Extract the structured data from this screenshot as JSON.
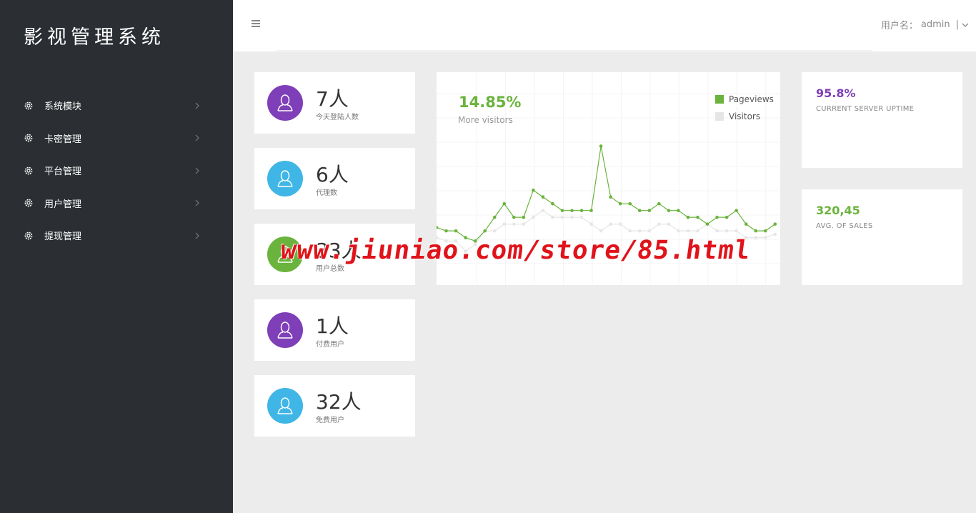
{
  "app": {
    "title": "影视管理系统"
  },
  "sidebar": {
    "items": [
      {
        "label": "系统模块"
      },
      {
        "label": "卡密管理"
      },
      {
        "label": "平台管理"
      },
      {
        "label": "用户管理"
      },
      {
        "label": "提现管理"
      }
    ]
  },
  "header": {
    "user_label": "用户名：",
    "username": "admin",
    "separator": "|",
    "menu_icon": "hamburger-icon"
  },
  "stats": [
    {
      "value": "7人",
      "label": "今天登陆人数",
      "color": "#7e3fb8",
      "icon": "user-icon"
    },
    {
      "value": "6人",
      "label": "代理数",
      "color": "#3fb6e6",
      "icon": "user-icon"
    },
    {
      "value": "33人",
      "label": "用户总数",
      "color": "#6ab33c",
      "icon": "user-icon"
    },
    {
      "value": "1人",
      "label": "付费用户",
      "color": "#7e3fb8",
      "icon": "user-icon"
    },
    {
      "value": "32人",
      "label": "免费用户",
      "color": "#3fb6e6",
      "icon": "user-icon"
    }
  ],
  "visitors_panel": {
    "percent": "14.85%",
    "subtitle": "More visitors"
  },
  "chart_data": {
    "type": "line",
    "x": [
      1,
      2,
      3,
      4,
      5,
      6,
      7,
      8,
      9,
      10,
      11,
      12,
      13,
      14,
      15,
      16,
      17,
      18,
      19,
      20,
      21,
      22,
      23,
      24,
      25,
      26,
      27,
      28,
      29,
      30,
      31,
      32,
      33,
      34,
      35,
      36,
      37
    ],
    "series": [
      {
        "name": "Pageviews",
        "color": "#6ab33c",
        "values": [
          17,
          16,
          16,
          14,
          13,
          16,
          20,
          24,
          20,
          20,
          28,
          26,
          24,
          22,
          22,
          22,
          22,
          41,
          26,
          24,
          24,
          22,
          22,
          24,
          22,
          22,
          20,
          20,
          18,
          20,
          20,
          22,
          18,
          16,
          16,
          18,
          null
        ]
      },
      {
        "name": "Visitors",
        "color": "#e6e6e6",
        "values": [
          14,
          13,
          13,
          10,
          12,
          16,
          16,
          18,
          18,
          18,
          20,
          22,
          20,
          20,
          20,
          20,
          18,
          16,
          18,
          18,
          16,
          16,
          16,
          18,
          18,
          16,
          16,
          16,
          18,
          16,
          16,
          16,
          14,
          14,
          14,
          15,
          null
        ]
      }
    ],
    "grid": true,
    "legend": "top-right"
  },
  "uptime": {
    "value": "95.8%",
    "label": "CURRENT SERVER UPTIME",
    "color": "#7e3fb8"
  },
  "sales": {
    "value": "320,45",
    "label": "AVG. OF SALES",
    "color": "#6ab33c"
  },
  "watermark": {
    "text": "www.jiuniao.com/store/85.html"
  }
}
